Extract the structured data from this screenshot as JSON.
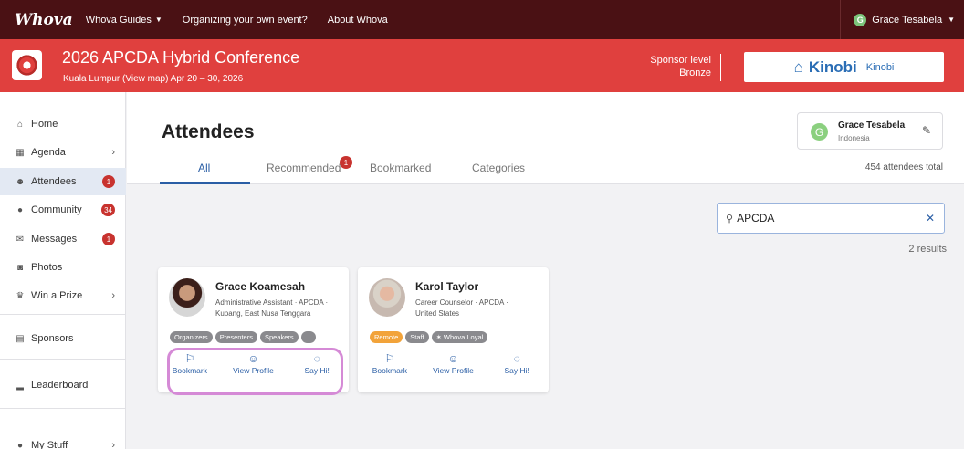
{
  "topnav": {
    "logo": "Whova",
    "links": [
      "Whova Guides",
      "Organizing your own event?",
      "About Whova"
    ],
    "user_initial": "G",
    "user_name": "Grace Tesabela"
  },
  "banner": {
    "title": "2026 APCDA Hybrid Conference",
    "subtitle": "Kuala Lumpur (View map)  Apr 20 – 30, 2026",
    "sponsor_label": "Sponsor level",
    "sponsor_level": "Bronze",
    "sponsor_logo_text": "Kinobi",
    "sponsor_name": "Kinobi"
  },
  "sidebar": {
    "items": [
      {
        "label": "Home",
        "icon": "home-icon"
      },
      {
        "label": "Agenda",
        "icon": "calendar-icon"
      },
      {
        "label": "Attendees",
        "icon": "people-icon",
        "badge": "1"
      },
      {
        "label": "Community",
        "icon": "chat-bubbles-icon",
        "badge": "34"
      },
      {
        "label": "Messages",
        "icon": "envelope-icon",
        "badge": "1"
      },
      {
        "label": "Photos",
        "icon": "camera-icon"
      },
      {
        "label": "Win a Prize",
        "icon": "trophy-icon"
      },
      {
        "label": "Sponsors",
        "icon": "building-icon"
      },
      {
        "label": "Leaderboard",
        "icon": "leaderboard-icon"
      },
      {
        "label": "My Stuff",
        "icon": "user-dot-icon"
      }
    ]
  },
  "main": {
    "title": "Attendees",
    "tabs": [
      {
        "label": "All"
      },
      {
        "label": "Recommended",
        "badge": "1"
      },
      {
        "label": "Bookmarked"
      },
      {
        "label": "Categories"
      }
    ],
    "profile": {
      "initial": "G",
      "name": "Grace Tesabela",
      "country": "Indonesia"
    },
    "total": "454 attendees total",
    "search": {
      "value": "APCDA"
    },
    "results": "2 results"
  },
  "cards": [
    {
      "name": "Grace Koamesah",
      "role_line1": "Administrative Assistant · APCDA ·",
      "role_line2": "Kupang, East Nusa Tenggara",
      "tags": [
        "Organizers",
        "Presenters",
        "Speakers",
        "..."
      ],
      "actions": [
        "Bookmark",
        "View Profile",
        "Say Hi!"
      ]
    },
    {
      "name": "Karol Taylor",
      "role_line1": "Career Counselor · APCDA ·",
      "role_line2": "United States",
      "tags": [
        "Remote",
        "Staff",
        "✶ Whova Loyal"
      ],
      "actions": [
        "Bookmark",
        "View Profile",
        "Say Hi!"
      ]
    }
  ],
  "colors": {
    "topnav": "#4a1114",
    "banner": "#e0403e",
    "accent": "#2a5ea5",
    "badge": "#c8332f",
    "highlight": "#d58ad6"
  }
}
